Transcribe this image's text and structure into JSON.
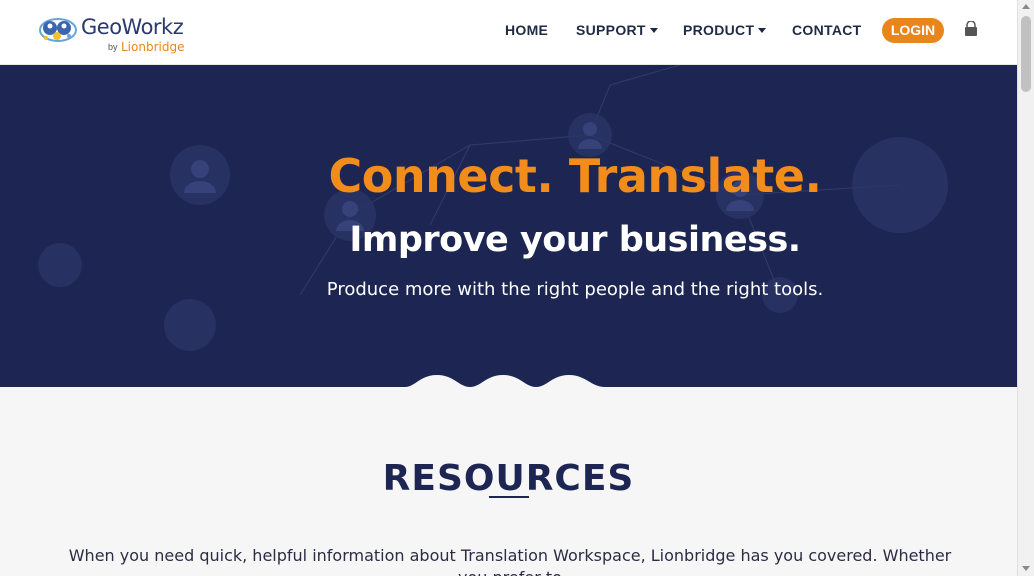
{
  "brand": {
    "name": "GeoWorkz",
    "by": "by",
    "parent": "Lionbridge"
  },
  "nav": {
    "home": "HOME",
    "support": "SUPPORT",
    "product": "PRODUCT",
    "contact": "CONTACT",
    "login": "LOGIN"
  },
  "icons": {
    "cart": "shopping-bag-icon",
    "dropdown": "caret-down-icon"
  },
  "hero": {
    "title": "Connect. Translate.",
    "subtitle": "Improve your business.",
    "text": "Produce more with the right people and the right tools."
  },
  "resources": {
    "title": "RESOURCES",
    "body": "When you need quick, helpful information about Translation Workspace, Lionbridge has you covered. Whether you prefer to"
  },
  "colors": {
    "navy": "#1d2652",
    "orange": "#e8861c",
    "white": "#ffffff"
  }
}
